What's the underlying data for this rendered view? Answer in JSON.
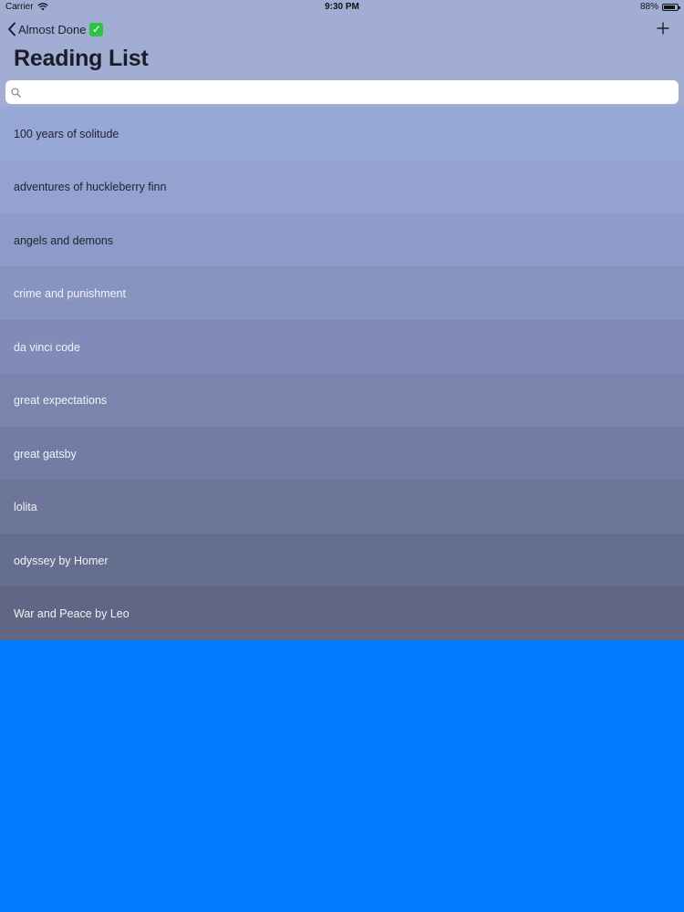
{
  "status_bar": {
    "carrier": "Carrier",
    "time": "9:30 PM",
    "battery": "88%",
    "battery_level": 0.88
  },
  "nav": {
    "back_label": "Almost Done",
    "back_emoji": "✓",
    "add_icon": "plus-icon"
  },
  "title": "Reading List",
  "search": {
    "placeholder": "",
    "value": ""
  },
  "books": [
    "100 years of solitude",
    "adventures of huckleberry finn",
    "angels and demons",
    "crime and punishment",
    "da vinci code",
    "great expectations",
    "great gatsby",
    "lolita",
    "odyssey by Homer",
    "War and Peace by Leo"
  ],
  "colors": {
    "header": "#A2ADD4",
    "background": "#007AFF",
    "checkmark": "#31C048"
  }
}
